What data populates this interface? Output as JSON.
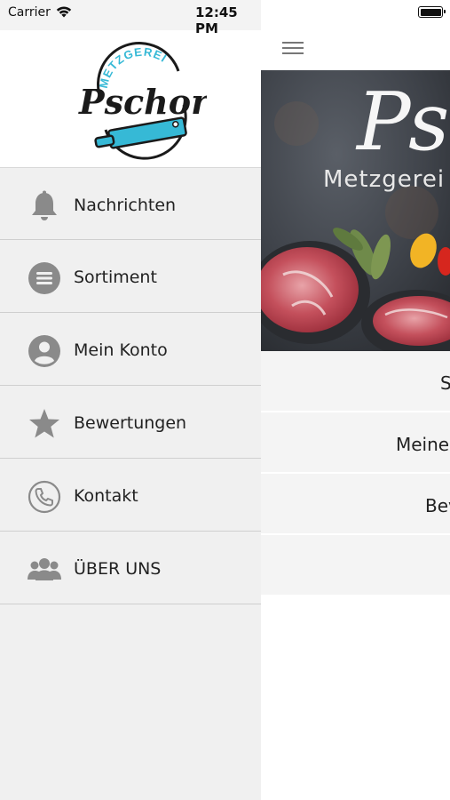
{
  "status_bar": {
    "carrier": "Carrier",
    "time": "12:45 PM",
    "icons": [
      "wifi-icon",
      "battery-icon"
    ]
  },
  "drawer": {
    "logo": {
      "top_text": "METZGEREI",
      "name": "Pschorr"
    },
    "items": [
      {
        "label": "Nachrichten",
        "icon": "bell-icon"
      },
      {
        "label": "Sortiment",
        "icon": "list-icon"
      },
      {
        "label": "Mein Konto",
        "icon": "user-icon"
      },
      {
        "label": "Bewertungen",
        "icon": "star-icon"
      },
      {
        "label": "Kontakt",
        "icon": "phone-icon"
      },
      {
        "label": "ÜBER UNS",
        "icon": "group-icon"
      }
    ]
  },
  "main": {
    "menu_icon": "hamburger-icon",
    "hero": {
      "title": "Psc",
      "subtitle": "Metzgerei"
    },
    "rows": [
      "S",
      "Meine",
      "Bev",
      ""
    ]
  },
  "colors": {
    "drawer_bg": "#f0f0f0",
    "icon_gray": "#8a8a8a",
    "logo_accent": "#36b9d6",
    "logo_dark": "#1a1a1a"
  }
}
